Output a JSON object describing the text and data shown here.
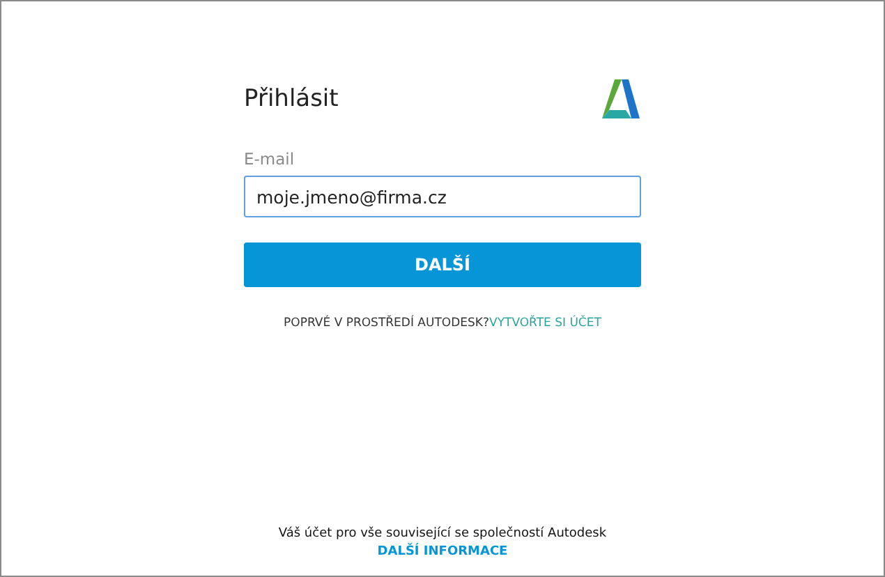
{
  "title": "Přihlásit",
  "email": {
    "label": "E-mail",
    "value": "moje.jmeno@firma.cz"
  },
  "next_button": "DALŠÍ",
  "signup": {
    "prompt": "POPRVÉ V PROSTŘEDÍ AUTODESK?",
    "link": "VYTVOŘTE SI ÚČET"
  },
  "footer": {
    "text": "Váš účet pro vše související se společností Autodesk",
    "link": "DALŠÍ INFORMACE"
  }
}
